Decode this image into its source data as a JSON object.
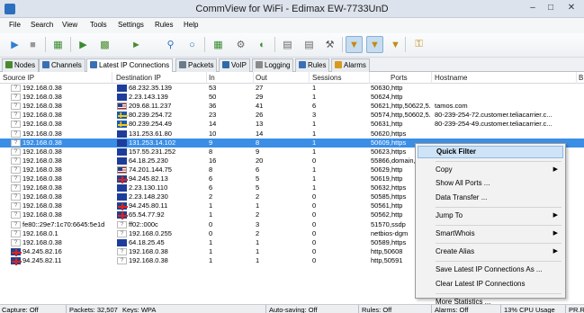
{
  "window": {
    "title": "CommView for WiFi - Edimax EW-7733UnD"
  },
  "menu": [
    "File",
    "Search",
    "View",
    "Tools",
    "Settings",
    "Rules",
    "Help"
  ],
  "toolbar": {
    "buttons": [
      "start-capture",
      "stop-capture",
      "open-log",
      "load",
      "save",
      "wireless",
      "reconstruct",
      "node-reassoc",
      "statistics",
      "wep-keys",
      "packet-generator",
      "ip-aliases",
      "mac-aliases",
      "settings",
      "filter-mac",
      "filter-ip",
      "filter-custom",
      "keys"
    ]
  },
  "tabs": [
    {
      "label": "Nodes",
      "color": "#4a8a2e"
    },
    {
      "label": "Channels",
      "color": "#3b6fb6"
    },
    {
      "label": "Latest IP Connections",
      "color": "#3b6fb6",
      "active": true
    },
    {
      "label": "Packets",
      "color": "#6b7b8c"
    },
    {
      "label": "VoIP",
      "color": "#2f6aa8"
    },
    {
      "label": "Logging",
      "color": "#8a8a8a"
    },
    {
      "label": "Rules",
      "color": "#3b6fb6"
    },
    {
      "label": "Alarms",
      "color": "#d89a1e"
    }
  ],
  "columns": [
    "Source IP",
    "Destination IP",
    "In",
    "Out",
    "Sessions",
    "Ports",
    "Hostname",
    "B"
  ],
  "rows": [
    {
      "src_flag": "?",
      "src": "192.168.0.38",
      "dst_flag": "eu",
      "dst": "68.232.35.139",
      "in": "53",
      "out": "27",
      "sessions": "1",
      "ports": "50630,http",
      "host": ""
    },
    {
      "src_flag": "?",
      "src": "192.168.0.38",
      "dst_flag": "eu",
      "dst": "2.23.143.139",
      "in": "50",
      "out": "29",
      "sessions": "1",
      "ports": "50624,http",
      "host": ""
    },
    {
      "src_flag": "?",
      "src": "192.168.0.38",
      "dst_flag": "us",
      "dst": "209.68.11.237",
      "in": "36",
      "out": "41",
      "sessions": "6",
      "ports": "50621,http,50622,5...",
      "host": "tamos.com"
    },
    {
      "src_flag": "?",
      "src": "192.168.0.38",
      "dst_flag": "se",
      "dst": "80.239.254.72",
      "in": "23",
      "out": "26",
      "sessions": "3",
      "ports": "50574,http,50602,5...",
      "host": "80-239-254-72.customer.teliacarrier.c..."
    },
    {
      "src_flag": "?",
      "src": "192.168.0.38",
      "dst_flag": "se",
      "dst": "80.239.254.49",
      "in": "14",
      "out": "13",
      "sessions": "1",
      "ports": "50631,http",
      "host": "80-239-254-49.customer.teliacarrier.c..."
    },
    {
      "src_flag": "?",
      "src": "192.168.0.38",
      "dst_flag": "eu",
      "dst": "131.253.61.80",
      "in": "10",
      "out": "14",
      "sessions": "1",
      "ports": "50620,https",
      "host": ""
    },
    {
      "src_flag": "?",
      "src": "192.168.0.38",
      "dst_flag": "eu",
      "dst": "131.253.14.102",
      "in": "9",
      "out": "8",
      "sessions": "1",
      "ports": "50609,https",
      "host": "",
      "selected": true
    },
    {
      "src_flag": "?",
      "src": "192.168.0.38",
      "dst_flag": "eu",
      "dst": "157.55.231.252",
      "in": "8",
      "out": "9",
      "sessions": "1",
      "ports": "50623,https",
      "host": ""
    },
    {
      "src_flag": "?",
      "src": "192.168.0.38",
      "dst_flag": "eu",
      "dst": "64.18.25.230",
      "in": "16",
      "out": "20",
      "sessions": "0",
      "ports": "55866,domain,5...",
      "host": ""
    },
    {
      "src_flag": "?",
      "src": "192.168.0.38",
      "dst_flag": "us",
      "dst": "74.201.144.75",
      "in": "8",
      "out": "6",
      "sessions": "1",
      "ports": "50629,http",
      "host": ""
    },
    {
      "src_flag": "?",
      "src": "192.168.0.38",
      "dst_flag": "gb",
      "dst": "94.245.82.13",
      "in": "6",
      "out": "5",
      "sessions": "1",
      "ports": "50619,http",
      "host": ""
    },
    {
      "src_flag": "?",
      "src": "192.168.0.38",
      "dst_flag": "eu",
      "dst": "2.23.130.110",
      "in": "6",
      "out": "5",
      "sessions": "1",
      "ports": "50632,https",
      "host": ""
    },
    {
      "src_flag": "?",
      "src": "192.168.0.38",
      "dst_flag": "eu",
      "dst": "2.23.148.230",
      "in": "2",
      "out": "2",
      "sessions": "0",
      "ports": "50585,https",
      "host": ""
    },
    {
      "src_flag": "?",
      "src": "192.168.0.38",
      "dst_flag": "gb",
      "dst": "94.245.80.11",
      "in": "1",
      "out": "1",
      "sessions": "0",
      "ports": "50561,http",
      "host": ""
    },
    {
      "src_flag": "?",
      "src": "192.168.0.38",
      "dst_flag": "gb",
      "dst": "65.54.77.92",
      "in": "1",
      "out": "2",
      "sessions": "0",
      "ports": "50562,http",
      "host": ""
    },
    {
      "src_flag": "?",
      "src": "fe80::29e7:1c70:6645:5e1d",
      "dst_flag": "?",
      "dst": "ff02::000c",
      "in": "0",
      "out": "3",
      "sessions": "0",
      "ports": "51570,ssdp",
      "host": ""
    },
    {
      "src_flag": "?",
      "src": "192.168.0.1",
      "dst_flag": "?",
      "dst": "192.168.0.255",
      "in": "0",
      "out": "2",
      "sessions": "0",
      "ports": "netbios-dgm",
      "host": ""
    },
    {
      "src_flag": "?",
      "src": "192.168.0.38",
      "dst_flag": "eu",
      "dst": "64.18.25.45",
      "in": "1",
      "out": "1",
      "sessions": "0",
      "ports": "50589,https",
      "host": ""
    },
    {
      "src_flag": "gb",
      "src": "94.245.82.16",
      "dst_flag": "?",
      "dst": "192.168.0.38",
      "in": "1",
      "out": "1",
      "sessions": "0",
      "ports": "http,50608",
      "host": ""
    },
    {
      "src_flag": "gb",
      "src": "94.245.82.11",
      "dst_flag": "?",
      "dst": "192.168.0.38",
      "in": "1",
      "out": "1",
      "sessions": "0",
      "ports": "http,50591",
      "host": ""
    }
  ],
  "context_menu": {
    "items": [
      {
        "label": "Quick Filter",
        "highlighted": true
      },
      {
        "sep": true
      },
      {
        "label": "Copy",
        "submenu": true
      },
      {
        "label": "Show All Ports ..."
      },
      {
        "label": "Data Transfer ..."
      },
      {
        "sep": true
      },
      {
        "label": "Jump To",
        "submenu": true
      },
      {
        "sep": true
      },
      {
        "label": "SmartWhois",
        "submenu": true
      },
      {
        "sep": true
      },
      {
        "label": "Create Alias",
        "submenu": true
      },
      {
        "sep": true
      },
      {
        "label": "Save Latest IP Connections As ..."
      },
      {
        "label": "Clear Latest IP Connections"
      },
      {
        "sep": true
      },
      {
        "label": "More Statistics ..."
      }
    ]
  },
  "status": {
    "capture": "Capture: Off",
    "packets": "Packets: 32,507",
    "keys": "Keys: WPA",
    "autosaving": "Auto-saving: Off",
    "rules": "Rules: Off",
    "alarms": "Alarms: Off",
    "cpu": "13% CPU Usage",
    "pr": "PR.R"
  }
}
